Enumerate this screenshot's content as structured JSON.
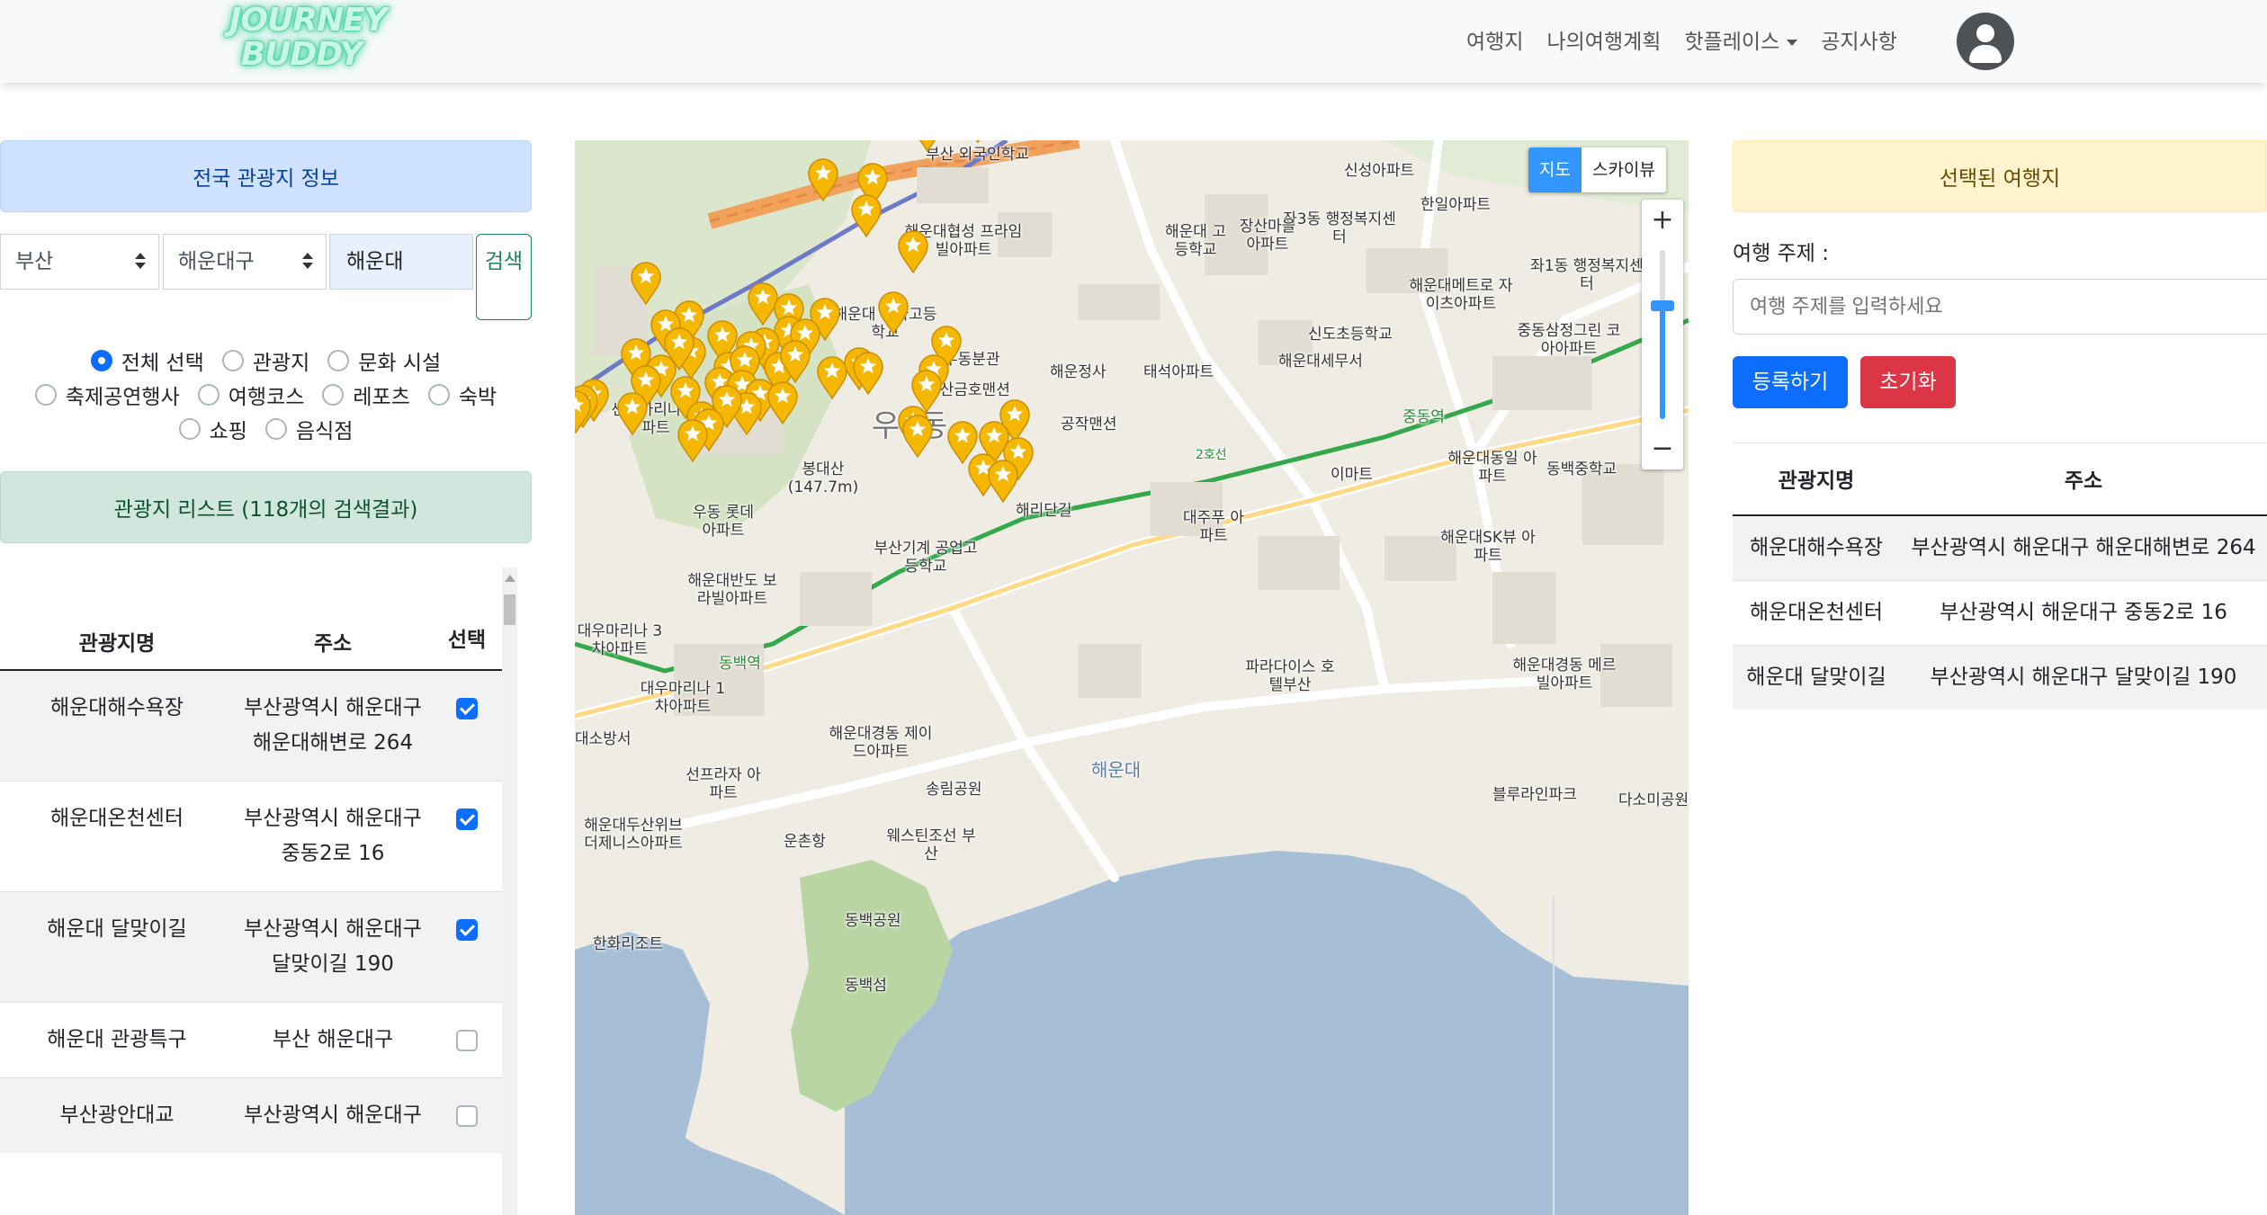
{
  "nav": {
    "logo_line1": "JOURNEY",
    "logo_line2": "BUDDY",
    "links": [
      "여행지",
      "나의여행계획",
      "핫플레이스",
      "공지사항"
    ]
  },
  "left": {
    "title": "전국 관광지 정보",
    "region": "부산",
    "district": "해운대구",
    "keyword": "해운대",
    "search_label": "검색",
    "filters": [
      "전체 선택",
      "관광지",
      "문화 시설",
      "축제공연행사",
      "여행코스",
      "레포츠",
      "숙박",
      "쇼핑",
      "음식점"
    ],
    "selected_filter": "전체 선택",
    "result_title": "관광지 리스트 (118개의 검색결과)",
    "columns": [
      "관광지명",
      "주소",
      "선택"
    ],
    "rows": [
      {
        "name": "해운대해수욕장",
        "address": "부산광역시 해운대구 해운대해변로 264",
        "checked": true
      },
      {
        "name": "해운대온천센터",
        "address": "부산광역시 해운대구 중동2로 16",
        "checked": true
      },
      {
        "name": "해운대 달맞이길",
        "address": "부산광역시 해운대구 달맞이길 190",
        "checked": true
      },
      {
        "name": "해운대 관광특구",
        "address": "부산 해운대구",
        "checked": false
      },
      {
        "name": "부산광안대교",
        "address": "부산광역시 해운대구",
        "checked": false
      }
    ]
  },
  "map": {
    "type_map": "지도",
    "type_sky": "스카이뷰",
    "zoom_in": "+",
    "zoom_out": "−",
    "labels": [
      "부산 외국인학교",
      "신성아파트",
      "한일아파트",
      "좌3동 행정복지센터",
      "좌1동 행정복지센터",
      "해운대협성 프라임빌아파트",
      "해운대 고등학교",
      "장산마을 아파트",
      "신도초등학교",
      "해운대메트로 자이츠아파트",
      "해운대 여자고등학교",
      "우동분관",
      "해운정사",
      "태석아파트",
      "해운대세무서",
      "중동삼정그린 코아아파트",
      "벽산금호맨션",
      "우1동",
      "공작맨션",
      "센텀마리나 아파트",
      "봉대산 (147.7m)",
      "해운대동일 아파트",
      "동백중학교",
      "해리단길",
      "이마트",
      "우동 롯데아파트",
      "대주푸 아파트",
      "해운대SK뷰 아파트",
      "부산기계 공업고등학교",
      "해운대반도 보라빌아파트",
      "대우마리나 3차아파트",
      "해운대경동 메르빌아파트",
      "대우마리나 1차아파트",
      "대소방서",
      "해운대경동 제이드아파트",
      "선프라자 아파트",
      "송림공원",
      "해운대",
      "웨스틴조선 부산",
      "운촌항",
      "해운대두산위브 더제니스아파트",
      "동백공원",
      "동백섬",
      "한화리조트",
      "파라다이스 호텔부산",
      "블루라인파크",
      "다소미공원",
      "동백역",
      "2호선",
      "중동역"
    ]
  },
  "right": {
    "title": "선택된 여행지",
    "theme_label": "여행 주제 :",
    "theme_placeholder": "여행 주제를 입력하세요",
    "register_label": "등록하기",
    "reset_label": "초기화",
    "columns": [
      "관광지명",
      "주소"
    ],
    "rows": [
      {
        "name": "해운대해수욕장",
        "address": "부산광역시 해운대구 해운대해변로 264"
      },
      {
        "name": "해운대온천센터",
        "address": "부산광역시 해운대구 중동2로 16"
      },
      {
        "name": "해운대 달맞이길",
        "address": "부산광역시 해운대구 달맞이길 190"
      }
    ]
  },
  "colors": {
    "primary": "#0d6efd",
    "danger": "#dc3545",
    "marker": "#f5b700",
    "sea": "#a7bfd6"
  }
}
